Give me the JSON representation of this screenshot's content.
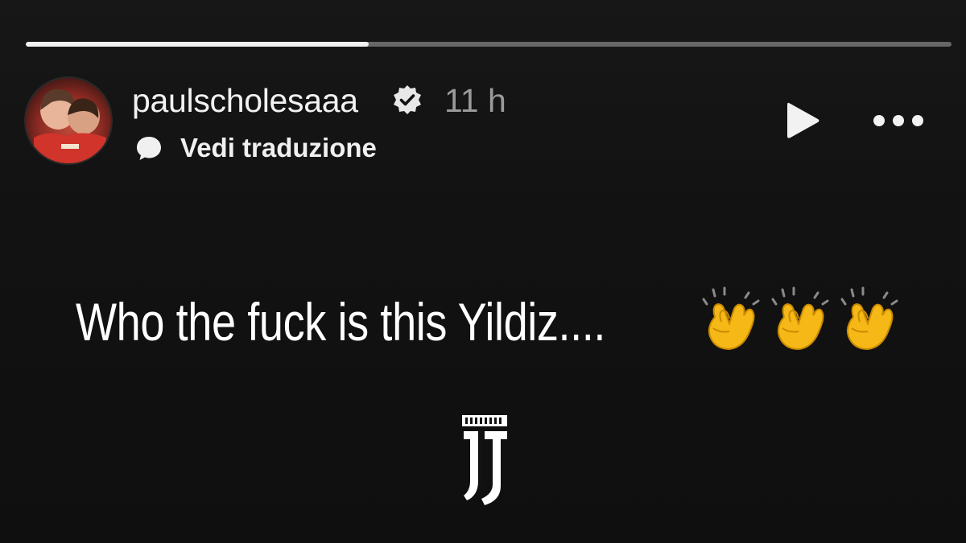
{
  "story": {
    "progress": {
      "segments": 1,
      "current_fraction": 0.37
    },
    "header": {
      "username": "paulscholesaaa",
      "verified": true,
      "time_ago": "11 h",
      "translate_label": "Vedi traduzione"
    },
    "content": {
      "text": "Who the fuck is this Yildiz....",
      "emoji": [
        "clapping-hands",
        "clapping-hands",
        "clapping-hands"
      ],
      "sticker": "juventus-logo"
    },
    "colors": {
      "background": "#121212",
      "text": "#ffffff",
      "muted": "#9a9a9a",
      "progress_track": "#5a5a5a",
      "progress_fill": "#f2f2f2",
      "emoji_yellow": "#f5b816"
    }
  }
}
